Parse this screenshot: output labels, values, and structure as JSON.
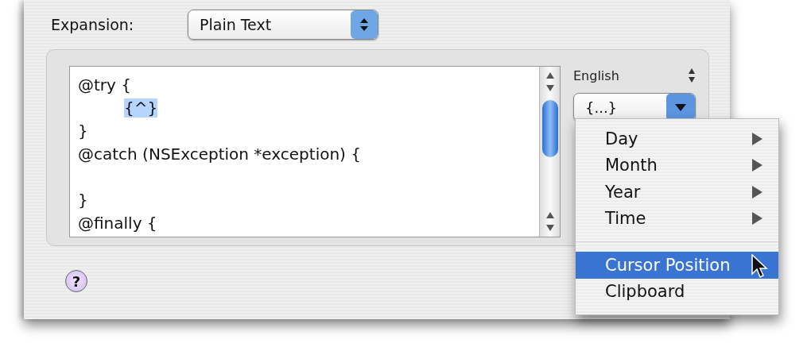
{
  "expansion": {
    "label": "Expansion:",
    "value": "Plain Text"
  },
  "editor": {
    "lines": [
      {
        "text": "@try {",
        "indented": false,
        "highlighted": false,
        "blank_before": false
      },
      {
        "text": "{^}",
        "indented": true,
        "highlighted": true,
        "blank_before": false
      },
      {
        "text": "}",
        "indented": false,
        "highlighted": false,
        "blank_before": false
      },
      {
        "text": "@catch (NSException *exception) {",
        "indented": false,
        "highlighted": false,
        "blank_before": false
      },
      {
        "text": "}",
        "indented": false,
        "highlighted": false,
        "blank_before": true
      },
      {
        "text": "@finally {",
        "indented": false,
        "highlighted": false,
        "blank_before": false
      }
    ]
  },
  "language": {
    "label": "English"
  },
  "placeholder_popup": {
    "value": "{...}",
    "open": true
  },
  "menu": {
    "items": [
      {
        "kind": "item",
        "label": "Day",
        "submenu": true,
        "selected": false
      },
      {
        "kind": "item",
        "label": "Month",
        "submenu": true,
        "selected": false
      },
      {
        "kind": "item",
        "label": "Year",
        "submenu": true,
        "selected": false
      },
      {
        "kind": "item",
        "label": "Time",
        "submenu": true,
        "selected": false
      },
      {
        "kind": "separator"
      },
      {
        "kind": "item",
        "label": "Cursor Position",
        "submenu": false,
        "selected": true
      },
      {
        "kind": "item",
        "label": "Clipboard",
        "submenu": false,
        "selected": false
      }
    ]
  },
  "help_button": {
    "label": "?"
  }
}
